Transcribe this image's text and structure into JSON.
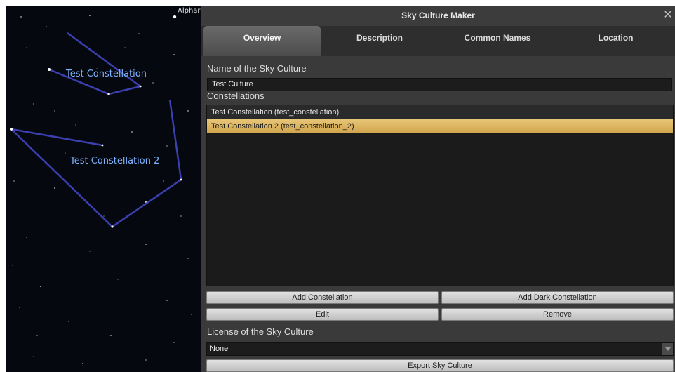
{
  "sky": {
    "star_label": "Alphard",
    "constellation_labels": [
      "Test Constellation",
      "Test Constellation 2"
    ]
  },
  "dialog": {
    "title": "Sky Culture Maker",
    "close_glyph": "✕",
    "tabs": [
      {
        "label": "Overview",
        "active": true
      },
      {
        "label": "Description",
        "active": false
      },
      {
        "label": "Common Names",
        "active": false
      },
      {
        "label": "Location",
        "active": false
      }
    ],
    "name_section_label": "Name of the Sky Culture",
    "name_value": "Test Culture",
    "constellations_section_label": "Constellations",
    "constellations": [
      {
        "label": "Test Constellation (test_constellation)",
        "selected": false
      },
      {
        "label": "Test Constellation 2 (test_constellation_2)",
        "selected": true
      }
    ],
    "buttons": {
      "add_constellation": "Add Constellation",
      "add_dark_constellation": "Add Dark Constellation",
      "edit": "Edit",
      "remove": "Remove",
      "export": "Export Sky Culture"
    },
    "license_section_label": "License of the Sky Culture",
    "license_value": "None",
    "dropdown_icon": "chevron-down-icon"
  },
  "colors": {
    "sky_background": "#05080f",
    "constellation_line": "#3b3fb0",
    "constellation_label": "#7eb4ff",
    "selection": "#e8c677"
  }
}
